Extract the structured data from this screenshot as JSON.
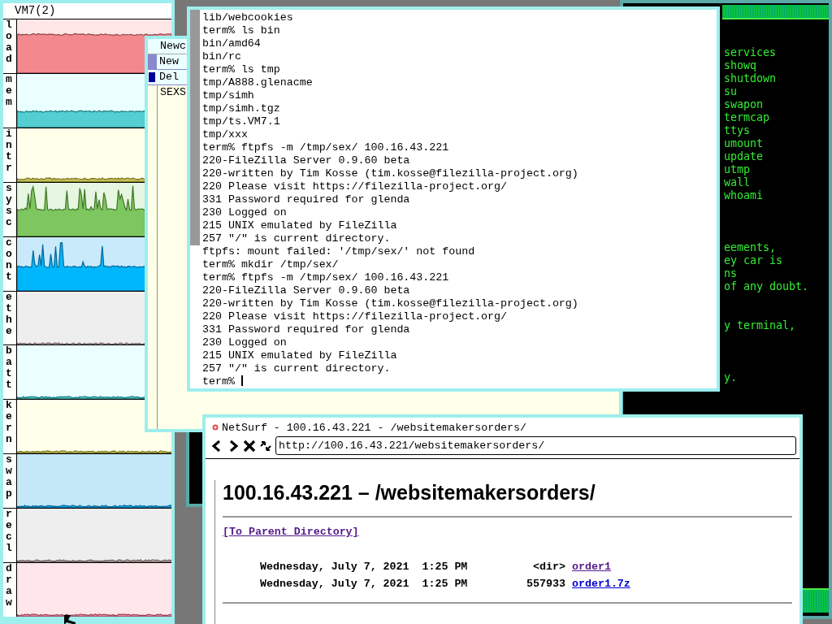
{
  "stats_window": {
    "title": "VM7(2)",
    "graphs": [
      {
        "label": "load",
        "color": "#ffe6e6"
      },
      {
        "label": "mem",
        "color": "#eaffff"
      },
      {
        "label": "intr",
        "color": "#ffffea"
      },
      {
        "label": "sysc",
        "color": "#e6f6e0"
      },
      {
        "label": "cont",
        "color": "#c8eafa"
      },
      {
        "label": "ethe",
        "color": "#eeeeee"
      },
      {
        "label": "batt",
        "color": "#eaffff"
      },
      {
        "label": "kern",
        "color": "#ffffea"
      },
      {
        "label": "swap",
        "color": "#c4e8f8"
      },
      {
        "label": "recl",
        "color": "#eeeeee"
      },
      {
        "label": "draw",
        "color": "#ffe6ea"
      }
    ]
  },
  "acme_window": {
    "column_tag": "Newc",
    "window_tag": "New",
    "file_tag": "Del",
    "body": "SEXS"
  },
  "terminal": {
    "lines": [
      "lib/webcookies",
      "term% ls bin",
      "bin/amd64",
      "bin/rc",
      "term% ls tmp",
      "tmp/A888.glenacme",
      "tmp/simh",
      "tmp/simh.tgz",
      "tmp/ts.VM7.1",
      "tmp/xxx",
      "term% ftpfs -m /tmp/sex/ 100.16.43.221",
      "220-FileZilla Server 0.9.60 beta",
      "220-written by Tim Kosse (tim.kosse@filezilla-project.org)",
      "220 Please visit https://filezilla-project.org/",
      "331 Password required for glenda",
      "230 Logged on",
      "215 UNIX emulated by FileZilla",
      "257 \"/\" is current directory.",
      "ftpfs: mount failed: '/tmp/sex/' not found",
      "term% mkdir /tmp/sex/",
      "term% ftpfs -m /tmp/sex/ 100.16.43.221",
      "220-FileZilla Server 0.9.60 beta",
      "220-written by Tim Kosse (tim.kosse@filezilla-project.org)",
      "220 Please visit https://filezilla-project.org/",
      "331 Password required for glenda",
      "230 Logged on",
      "215 UNIX emulated by FileZilla",
      "257 \"/\" is current directory.",
      "term%"
    ]
  },
  "green_terminal": {
    "lines": [
      "services",
      "showq",
      "shutdown",
      "su",
      "swapon",
      "termcap",
      "ttys",
      "umount",
      "update",
      "utmp",
      "wall",
      "whoami",
      "eements,",
      "ey car is",
      "ns",
      "of any doubt.",
      "y terminal,",
      "y."
    ]
  },
  "browser": {
    "title": "NetSurf - 100.16.43.221 - /websitemakersorders/",
    "url": "http://100.16.43.221/websitemakersorders/",
    "heading": "100.16.43.221 – /websitemakersorders/",
    "parent_link": "[To Parent Directory]",
    "entries": [
      {
        "date": "Wednesday, July 7, 2021  1:25 PM",
        "size": "<dir>",
        "name": "order1",
        "visited": true
      },
      {
        "date": "Wednesday, July 7, 2021  1:25 PM",
        "size": "557933",
        "name": "order1.7z",
        "visited": false
      }
    ]
  }
}
